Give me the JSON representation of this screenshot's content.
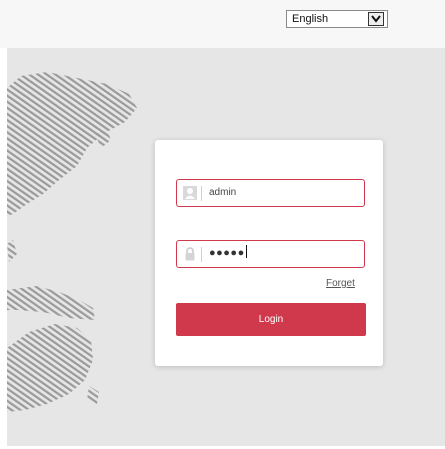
{
  "language": {
    "selected": "English"
  },
  "login": {
    "username_value": "admin",
    "password_masked": "●●●●●",
    "forget_label": "Forget",
    "login_label": "Login"
  },
  "colors": {
    "accent": "#d0394b",
    "background": "#e6e6e6",
    "card": "#ffffff"
  },
  "icons": {
    "username": "user-icon",
    "password": "lock-icon",
    "dropdown": "chevron-down-icon"
  }
}
